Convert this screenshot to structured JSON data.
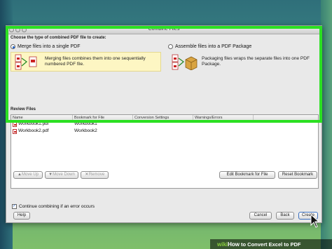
{
  "window": {
    "title": "Combine Files"
  },
  "choose_section": {
    "heading": "Choose the type of combined PDF file to create:"
  },
  "options": [
    {
      "label": "Merge files into a single PDF",
      "description": "Merging files combines them into one sequentially numbered PDF file.",
      "selected": true
    },
    {
      "label": "Assemble files into a PDF Package",
      "description": "Packaging files wraps the separate files into one PDF Package.",
      "selected": false
    }
  ],
  "review": {
    "heading": "Review Files",
    "columns": [
      "Name",
      "Bookmark for File",
      "Conversion Settings",
      "Warnings/Errors"
    ],
    "rows": [
      {
        "name": "Workbook1.pdf",
        "bookmark": "Workbook1",
        "conversion": "",
        "warnings": ""
      },
      {
        "name": "Workbook2.pdf",
        "bookmark": "Workbook2",
        "conversion": "",
        "warnings": ""
      }
    ]
  },
  "buttons": {
    "move_up": "Move Up",
    "move_down": "Move Down",
    "remove": "Remove",
    "edit_bookmark": "Edit Bookmark for File",
    "reset_bookmark": "Reset Bookmark",
    "help": "Help",
    "cancel": "Cancel",
    "back": "Back",
    "create": "Create"
  },
  "continue_checkbox": {
    "label": "Continue combining if an error occurs",
    "checked": true
  },
  "watermark": {
    "brand_prefix": "wiki",
    "brand_suffix": "How",
    "title": "to Convert Excel to PDF"
  },
  "colors": {
    "highlight": "#2be021",
    "selection": "#fdf6c3",
    "accent": "#1a5fc9"
  }
}
